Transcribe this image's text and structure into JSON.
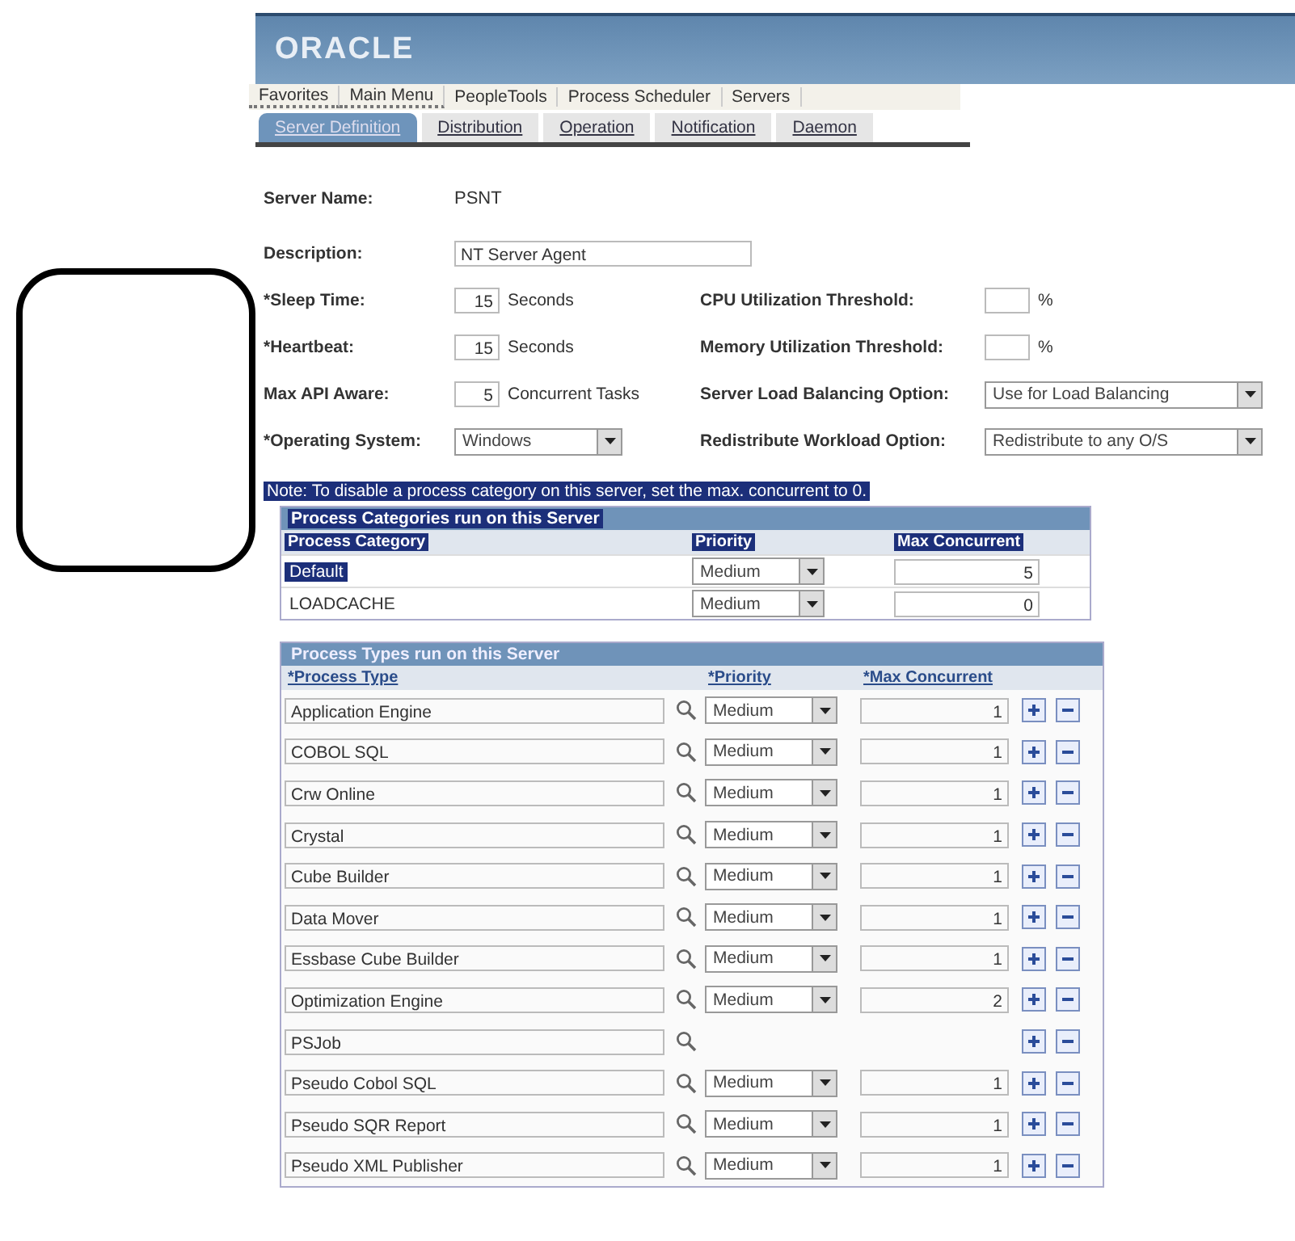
{
  "header": {
    "logo": "ORACLE"
  },
  "breadcrumb": [
    {
      "label": "Favorites",
      "dropdown": true
    },
    {
      "label": "Main Menu",
      "dropdown": true
    },
    {
      "label": "PeopleTools",
      "dropdown": false
    },
    {
      "label": "Process Scheduler",
      "dropdown": false
    },
    {
      "label": "Servers",
      "dropdown": false
    }
  ],
  "tabs": [
    {
      "label": "Server Definition",
      "selected": true
    },
    {
      "label": "Distribution",
      "selected": false
    },
    {
      "label": "Operation",
      "selected": false
    },
    {
      "label": "Notification",
      "selected": false
    },
    {
      "label": "Daemon",
      "selected": false
    }
  ],
  "server_name": {
    "label": "Server Name:",
    "value": "PSNT"
  },
  "description": {
    "label": "Description:",
    "value": "NT Server Agent"
  },
  "left_fields": [
    {
      "kind": "number",
      "label": "*Sleep Time:",
      "value": "15",
      "unit": "Seconds"
    },
    {
      "kind": "number",
      "label": "*Heartbeat:",
      "value": "15",
      "unit": "Seconds"
    },
    {
      "kind": "number",
      "label": "Max API Aware:",
      "value": "5",
      "unit": "Concurrent Tasks"
    },
    {
      "kind": "select",
      "label": "*Operating System:",
      "value": "Windows"
    }
  ],
  "right_fields": [
    {
      "kind": "number",
      "label": "CPU Utilization Threshold:",
      "unit": "%"
    },
    {
      "kind": "number",
      "label": "Memory Utilization Threshold:",
      "unit": "%"
    },
    {
      "kind": "select",
      "label": "Server Load Balancing Option:",
      "value": "Use for Load Balancing"
    },
    {
      "kind": "select",
      "label": "Redistribute Workload Option:",
      "value": "Redistribute to any O/S"
    }
  ],
  "note": {
    "text": "Note: To disable a process category on this server, set the max. concurrent to 0.",
    "highlighted": true
  },
  "categories": {
    "title": "Process Categories run on this Server",
    "highlighted": true,
    "columns": [
      "Process Category",
      "Priority",
      "Max Concurrent"
    ],
    "rows": [
      {
        "name": "Default",
        "priority": "Medium",
        "max": "5",
        "selected": true
      },
      {
        "name": "LOADCACHE",
        "priority": "Medium",
        "max": "0",
        "selected": false
      }
    ]
  },
  "types": {
    "title": "Process Types run on this Server",
    "columns": [
      "*Process Type",
      "*Priority",
      "*Max Concurrent"
    ],
    "rows": [
      {
        "name": "Application Engine",
        "priority": "Medium",
        "max": "1"
      },
      {
        "name": "COBOL SQL",
        "priority": "Medium",
        "max": "1"
      },
      {
        "name": "Crw Online",
        "priority": "Medium",
        "max": "1"
      },
      {
        "name": "Crystal",
        "priority": "Medium",
        "max": "1"
      },
      {
        "name": "Cube Builder",
        "priority": "Medium",
        "max": "1"
      },
      {
        "name": "Data Mover",
        "priority": "Medium",
        "max": "1"
      },
      {
        "name": "Essbase Cube Builder",
        "priority": "Medium",
        "max": "1"
      },
      {
        "name": "Optimization Engine",
        "priority": "Medium",
        "max": "2"
      },
      {
        "name": "PSJob"
      },
      {
        "name": "Pseudo Cobol SQL",
        "priority": "Medium",
        "max": "1"
      },
      {
        "name": "Pseudo SQR Report",
        "priority": "Medium",
        "max": "1"
      },
      {
        "name": "Pseudo XML Publisher",
        "priority": "Medium",
        "max": "1"
      }
    ]
  }
}
